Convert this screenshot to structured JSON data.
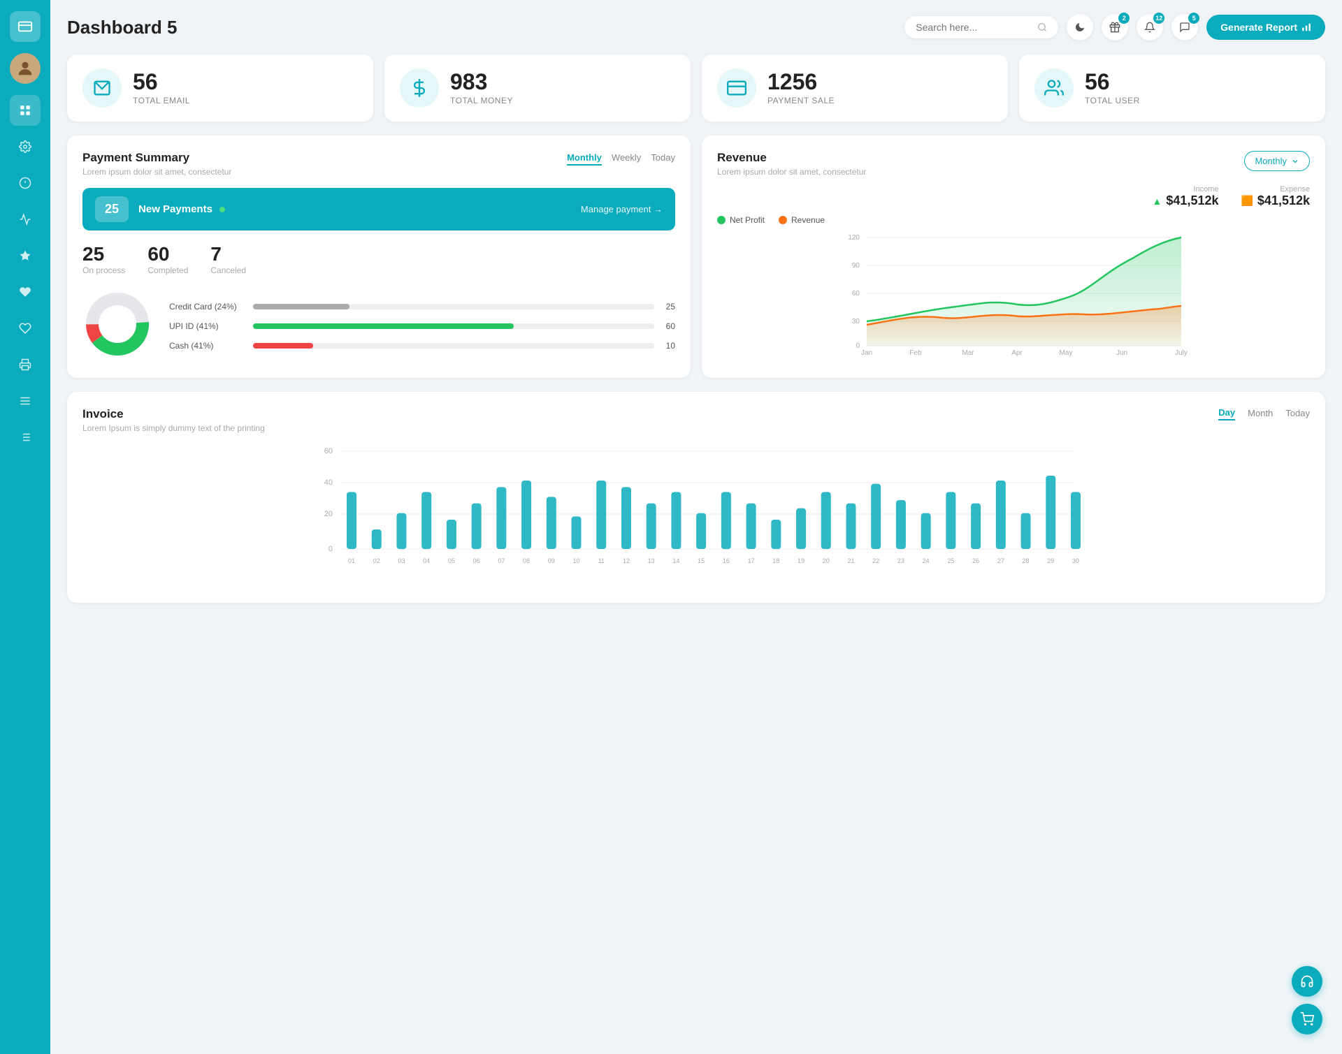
{
  "sidebar": {
    "logo_icon": "💳",
    "items": [
      {
        "id": "avatar",
        "icon": "👤",
        "active": false
      },
      {
        "id": "dashboard",
        "icon": "⊞",
        "active": true
      },
      {
        "id": "settings",
        "icon": "⚙",
        "active": false
      },
      {
        "id": "info",
        "icon": "ℹ",
        "active": false
      },
      {
        "id": "chart",
        "icon": "📊",
        "active": false
      },
      {
        "id": "star",
        "icon": "★",
        "active": false
      },
      {
        "id": "heart1",
        "icon": "♥",
        "active": false
      },
      {
        "id": "heart2",
        "icon": "♥",
        "active": false
      },
      {
        "id": "print",
        "icon": "🖨",
        "active": false
      },
      {
        "id": "menu",
        "icon": "≡",
        "active": false
      },
      {
        "id": "list",
        "icon": "☰",
        "active": false
      }
    ]
  },
  "header": {
    "title": "Dashboard 5",
    "search_placeholder": "Search here...",
    "dark_mode_icon": "🌙",
    "gift_icon": "🎁",
    "notification_icon": "🔔",
    "message_icon": "💬",
    "gift_badge": "2",
    "notification_badge": "12",
    "message_badge": "5",
    "generate_btn": "Generate Report"
  },
  "stats": [
    {
      "id": "email",
      "icon": "📋",
      "number": "56",
      "label": "TOTAL EMAIL"
    },
    {
      "id": "money",
      "icon": "$",
      "number": "983",
      "label": "TOTAL MONEY"
    },
    {
      "id": "payment",
      "icon": "💳",
      "number": "1256",
      "label": "PAYMENT SALE"
    },
    {
      "id": "user",
      "icon": "👥",
      "number": "56",
      "label": "TOTAL USER"
    }
  ],
  "payment_summary": {
    "title": "Payment Summary",
    "subtitle": "Lorem ipsum dolor sit amet, consectetur",
    "tabs": [
      "Monthly",
      "Weekly",
      "Today"
    ],
    "active_tab": "Monthly",
    "new_payments_count": "25",
    "new_payments_label": "New Payments",
    "manage_link": "Manage payment →",
    "metrics": [
      {
        "value": "25",
        "label": "On process"
      },
      {
        "value": "60",
        "label": "Completed"
      },
      {
        "value": "7",
        "label": "Canceled"
      }
    ],
    "payment_methods": [
      {
        "label": "Credit Card (24%)",
        "percent": 24,
        "value": 25,
        "color": "#aaa"
      },
      {
        "label": "UPI ID (41%)",
        "percent": 41,
        "value": 60,
        "color": "#22c55e"
      },
      {
        "label": "Cash (41%)",
        "percent": 10,
        "value": 10,
        "color": "#ef4444"
      }
    ]
  },
  "revenue": {
    "title": "Revenue",
    "subtitle": "Lorem ipsum dolor sit amet, consectetur",
    "period": "Monthly",
    "income_label": "Income",
    "income_amount": "$41,512k",
    "expense_label": "Expense",
    "expense_amount": "$41,512k",
    "legend": [
      {
        "label": "Net Profit",
        "color": "#22c55e"
      },
      {
        "label": "Revenue",
        "color": "#f97316"
      }
    ],
    "x_labels": [
      "Jan",
      "Feb",
      "Mar",
      "Apr",
      "May",
      "Jun",
      "July"
    ],
    "y_labels": [
      "0",
      "30",
      "60",
      "90",
      "120"
    ]
  },
  "invoice": {
    "title": "Invoice",
    "subtitle": "Lorem Ipsum is simply dummy text of the printing",
    "tabs": [
      "Day",
      "Month",
      "Today"
    ],
    "active_tab": "Day",
    "y_labels": [
      "0",
      "20",
      "40",
      "60"
    ],
    "x_labels": [
      "01",
      "02",
      "03",
      "04",
      "05",
      "06",
      "07",
      "08",
      "09",
      "10",
      "11",
      "12",
      "13",
      "14",
      "15",
      "16",
      "17",
      "18",
      "19",
      "20",
      "21",
      "22",
      "23",
      "24",
      "25",
      "26",
      "27",
      "28",
      "29",
      "30"
    ],
    "bar_data": [
      35,
      12,
      22,
      35,
      18,
      28,
      38,
      42,
      32,
      20,
      42,
      38,
      28,
      35,
      22,
      35,
      28,
      18,
      25,
      35,
      28,
      40,
      30,
      22,
      35,
      28,
      42,
      22,
      45,
      35
    ]
  },
  "float_btns": [
    {
      "icon": "🎧",
      "label": "support"
    },
    {
      "icon": "🛒",
      "label": "cart"
    }
  ]
}
